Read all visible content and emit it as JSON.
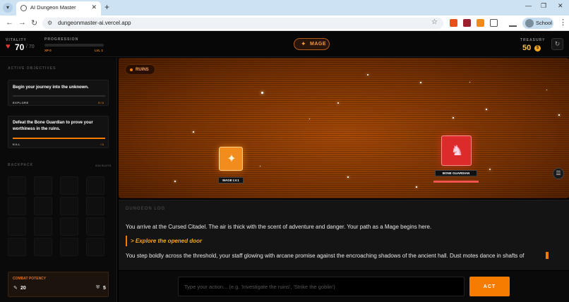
{
  "browser": {
    "tab_title": "AI Dungeon Master",
    "url": "dungeonmaster-ai.vercel.app",
    "profile_label": "School"
  },
  "header": {
    "vitality_label": "VITALITY",
    "vitality_value": "70",
    "vitality_max": "/ 70",
    "progression_label": "PROGRESSION",
    "xp_text": "XP 0",
    "level_text": "LVL 1",
    "xp_progress": 0,
    "class_label": "MAGE",
    "treasury_label": "TREASURY",
    "treasury_value": "50",
    "coin_symbol": "$"
  },
  "sidebar": {
    "objectives_label": "ACTIVE OBJECTIVES",
    "objectives": [
      {
        "text": "Begin your journey into the unknown.",
        "type": "EXPLORE",
        "count": "0 / 1",
        "progress": 0
      },
      {
        "text": "Defeat the Bone Guardian to prove your worthiness in the ruins.",
        "type": "KILL",
        "count": "/ 1",
        "progress": 1
      }
    ],
    "backpack_label": "BACKPACK",
    "backpack_count": "0/16 SLOTS",
    "combat_label": "COMBAT POTENCY",
    "attack_value": "20",
    "defense_value": "5"
  },
  "scene": {
    "location": "RUINS",
    "player_label": "MAGE LV.1",
    "enemy_label": "BONE GUARDIAN",
    "enemy_hp_fraction": 1
  },
  "log": {
    "title": "DUNGEON LOG",
    "entry1": "You arrive at the Cursed Citadel. The air is thick with the scent of adventure and danger. Your path as a Mage begins here.",
    "action": "> Explore the opened door",
    "entry2": "You step boldly across the threshold, your staff glowing with arcane promise against the encroaching shadows of the ancient hall. Dust motes dance in shafts of"
  },
  "input": {
    "placeholder": "Type your action... (e.g. 'Investigate the ruins', 'Strike the goblin')",
    "value": "",
    "act_label": "ACT"
  },
  "colors": {
    "accent": "#f57c00",
    "enemy": "#dd2b2b",
    "vitality": "#e53935",
    "gold": "#f2c14e"
  },
  "icons": [
    "heart-icon",
    "sparkle-icon",
    "coin-icon",
    "refresh-icon",
    "sword-icon",
    "shield-icon",
    "alien-icon",
    "settings-icon"
  ]
}
